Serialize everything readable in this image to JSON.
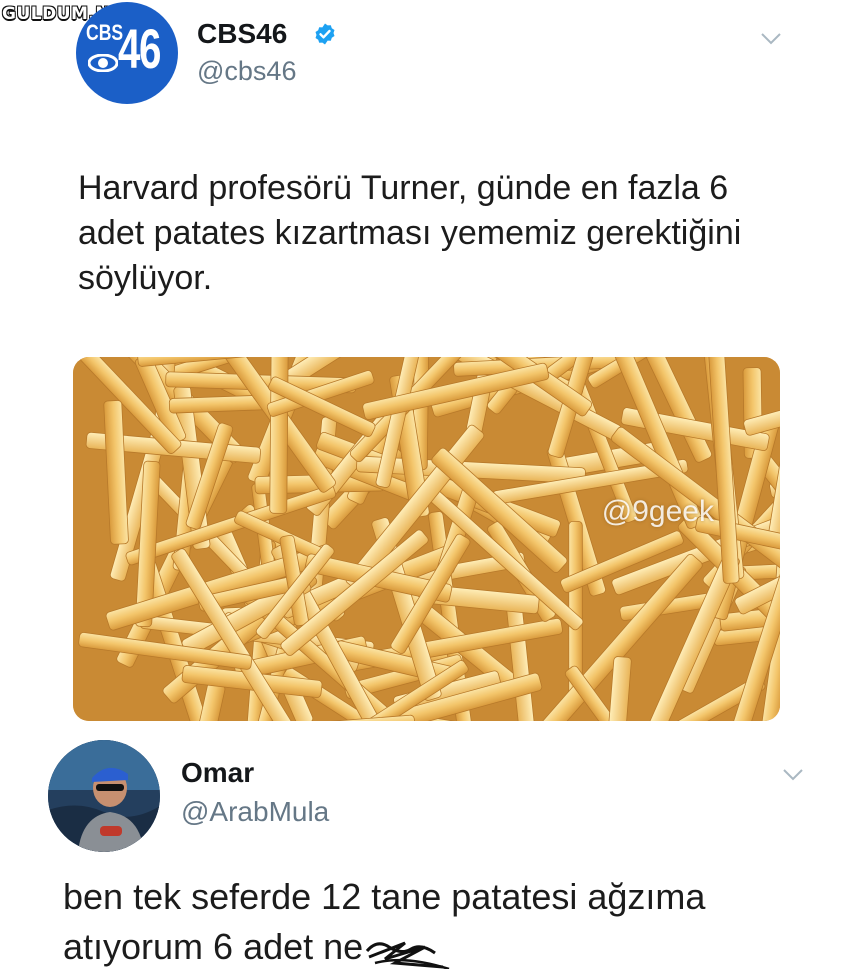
{
  "watermark": "GULDUM.NET",
  "tweets": [
    {
      "display_name": "CBS46",
      "handle": "@cbs46",
      "verified": true,
      "avatar": {
        "icon": "cbs46-logo",
        "text_small": "CBS",
        "text_large": "46",
        "color": "#1b5fc7"
      },
      "text": "Harvard profesörü Turner, günde en fazla 6 adet patates kızartması yememiz gerektiğini söylüyor.",
      "media": {
        "description_icon": "french-fries-photo",
        "tag": "@9geek"
      }
    },
    {
      "display_name": "Omar",
      "handle": "@ArabMula",
      "verified": false,
      "avatar": {
        "icon": "user-photo-avatar"
      },
      "text": "ben tek seferde 12 tane patatesi ağzıma atıyorum 6 adet ne"
    }
  ],
  "colors": {
    "verified_blue": "#1da1f2",
    "handle_gray": "#657786",
    "cbs_blue": "#1b5fc7"
  }
}
